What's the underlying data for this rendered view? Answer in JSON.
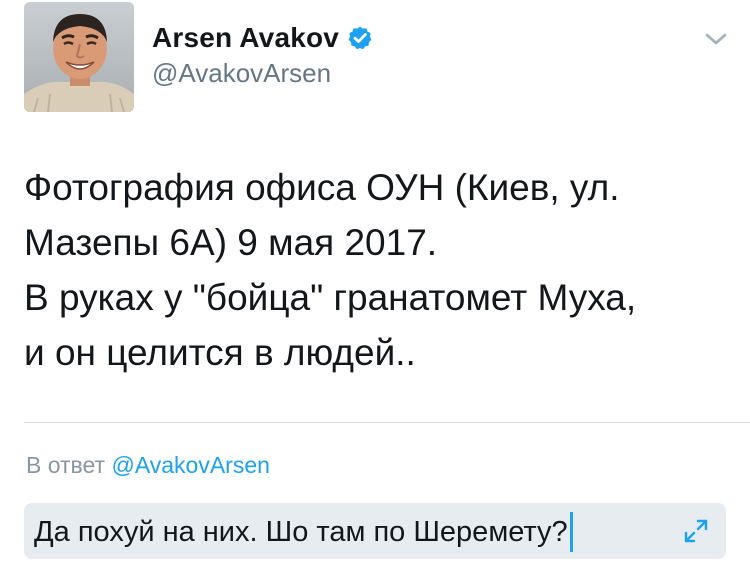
{
  "author": {
    "name": "Arsen Avakov",
    "handle": "@AvakovArsen"
  },
  "tweet": {
    "lines": [
      "Фотография офиса ОУН (Киев, ул.",
      "Мазепы 6А) 9 мая 2017.",
      "В руках у \"бойца\" гранатомет Муха,",
      "и он целится в людей.."
    ]
  },
  "reply": {
    "prefix": "В ответ",
    "mention": "@AvakovArsen",
    "draft": "Да похуй на них. Шо там по Шеремету?"
  },
  "icons": {
    "verified": "verified-badge-icon",
    "menu": "chevron-down-icon",
    "expand": "expand-arrows-icon"
  },
  "colors": {
    "accent": "#1da1f2",
    "secondary_text": "#657786",
    "reply_box_bg": "#e6ecf0"
  }
}
